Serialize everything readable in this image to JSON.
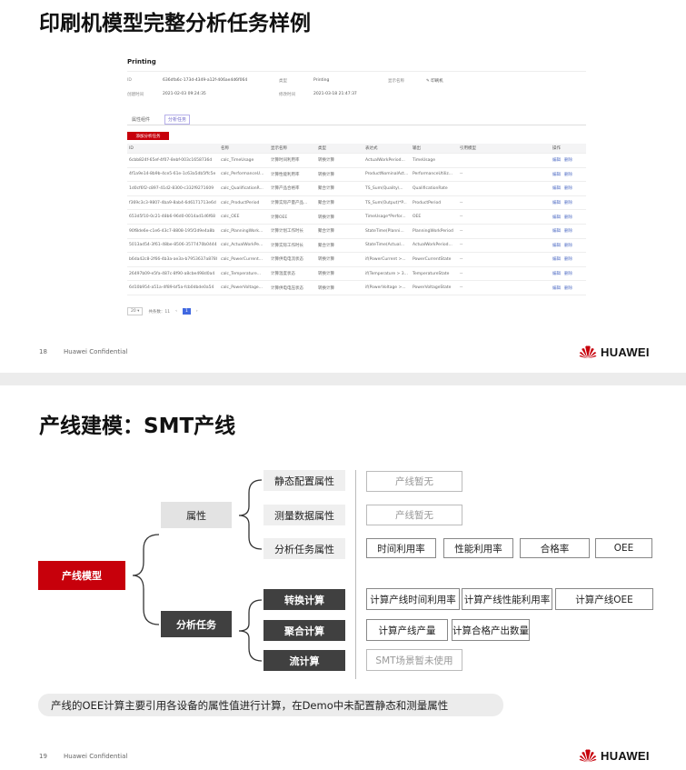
{
  "brand": {
    "name": "HUAWEI",
    "color": "#c7000b",
    "icon": "huawei-petal-logo"
  },
  "footer": {
    "confidential": "Huawei Confidential"
  },
  "slide1": {
    "title": "印刷机模型完整分析任务样例",
    "page": "18",
    "panel": {
      "title": "Printing",
      "info": [
        {
          "label": "ID",
          "value": "636dfa6c-173d-4349-a12f-406ae4d6f064"
        },
        {
          "label": "类型",
          "value": "Printing"
        },
        {
          "label": "显示名称",
          "value": "印刷机"
        },
        {
          "label": "创建时间",
          "value": "2021-02-03 09:24:35"
        },
        {
          "label": "修改时间",
          "value": "2021-03-18 21:47:37"
        }
      ],
      "tabs": [
        "属性组件",
        "分析任务"
      ],
      "add_button": "添加分析任务",
      "columns": [
        "ID",
        "名称",
        "显示名称",
        "类型",
        "表达式",
        "输出",
        "引用模型",
        "操作"
      ],
      "rows": [
        {
          "id": "6cbb824f-65ef-4f07-8ebf-003c1658736d",
          "name": "calc_TimeUsage",
          "display": "计算时间利用率",
          "type": "转换计算",
          "expr": "ActualWorkPeriod...",
          "output": "TimeUsage",
          "ref": ""
        },
        {
          "id": "4f1a9e14-8b9b-4ce5-61e-1c63a5db5ffc5e",
          "name": "calc_PerformanceU...",
          "display": "计算性能利用率",
          "type": "转换计算",
          "expr": "ProductNominalAct...",
          "output": "PerformanceUtiliz...",
          "ref": "--"
        },
        {
          "id": "1d0cf6f2-c897-41d2-8300-c332f9271609",
          "name": "calc_QualificationR...",
          "display": "计算产品合格率",
          "type": "聚合计算",
          "expr": "TS_Sum(Quality\\...",
          "output": "QualificationRate",
          "ref": ""
        },
        {
          "id": "f369c3c3-9807-4ba9-8ab4-6d6171713e6d",
          "name": "calc_ProductPeriod",
          "display": "计算实际产量产品...",
          "type": "聚合计算",
          "expr": "TS_Sum(Output)*P...",
          "output": "ProductPeriod",
          "ref": "--"
        },
        {
          "id": "653d5f10-0c21-48b6-96d0-0014ad1d6f68",
          "name": "calc_OEE",
          "display": "计算OEE",
          "type": "转换计算",
          "expr": "TimeUsage*Perfor...",
          "output": "OEE",
          "ref": "--"
        },
        {
          "id": "90f8de6e-c1e6-43c7-8808-195f2d9e4a8b",
          "name": "calc_PlanningWork...",
          "display": "计算计划工作时长",
          "type": "聚合计算",
          "expr": "StateTime(Planni...",
          "output": "PlanningWorkPeriod",
          "ref": "--"
        },
        {
          "id": "5013ad54-3f61-48be-8506-3577470b0444",
          "name": "calc_ActualWorkPe...",
          "display": "计算实际工作时长",
          "type": "聚合计算",
          "expr": "StateTime(Actual...",
          "output": "ActualWorkPeriod...",
          "ref": "--"
        },
        {
          "id": "b6da42c8-2f66-4b3a-ae3a-b7953637a8780",
          "name": "calc_PowerCurrent...",
          "display": "计算供电电流状态",
          "type": "转换计算",
          "expr": "if(PowerCurrent >...",
          "output": "PowerCurrentState",
          "ref": "--"
        },
        {
          "id": "26497b09-e5fa-487c-8f90-a8cbe498d0a4",
          "name": "calc_Temperature...",
          "display": "计算温度状态",
          "type": "转换计算",
          "expr": "if(Temperature > 3...",
          "output": "TemperatureState",
          "ref": "--"
        },
        {
          "id": "6d10b954-a51a-4f89-bf5a-fcb0dbde0a54",
          "name": "calc_PowerVoltage...",
          "display": "计算供电电压状态",
          "type": "转换计算",
          "expr": "if(PowerVoltage >...",
          "output": "PowerVoltageState",
          "ref": "--"
        }
      ],
      "ops": [
        "编辑",
        "删除"
      ],
      "pager": {
        "size": "20",
        "total": "共条数：11",
        "page": "1"
      }
    }
  },
  "slide2": {
    "title": "产线建模：SMT产线",
    "page": "19",
    "root": "产线模型",
    "branches": {
      "attr": "属性",
      "task": "分析任务"
    },
    "attr_items": [
      "静态配置属性",
      "测量数据属性",
      "分析任务属性"
    ],
    "task_items": [
      "转换计算",
      "聚合计算",
      "流计算"
    ],
    "values": {
      "static": "产线暂无",
      "measure": "产线暂无",
      "analysis": [
        "时间利用率",
        "性能利用率",
        "合格率",
        "OEE"
      ],
      "convert": [
        "计算产线时间利用率",
        "计算产线性能利用率",
        "计算产线OEE"
      ],
      "aggregate": [
        "计算产线产量",
        "计算合格产出数量"
      ],
      "stream": "SMT场景暂未使用"
    },
    "note": "产线的OEE计算主要引用各设备的属性值进行计算，在Demo中未配置静态和测量属性"
  }
}
